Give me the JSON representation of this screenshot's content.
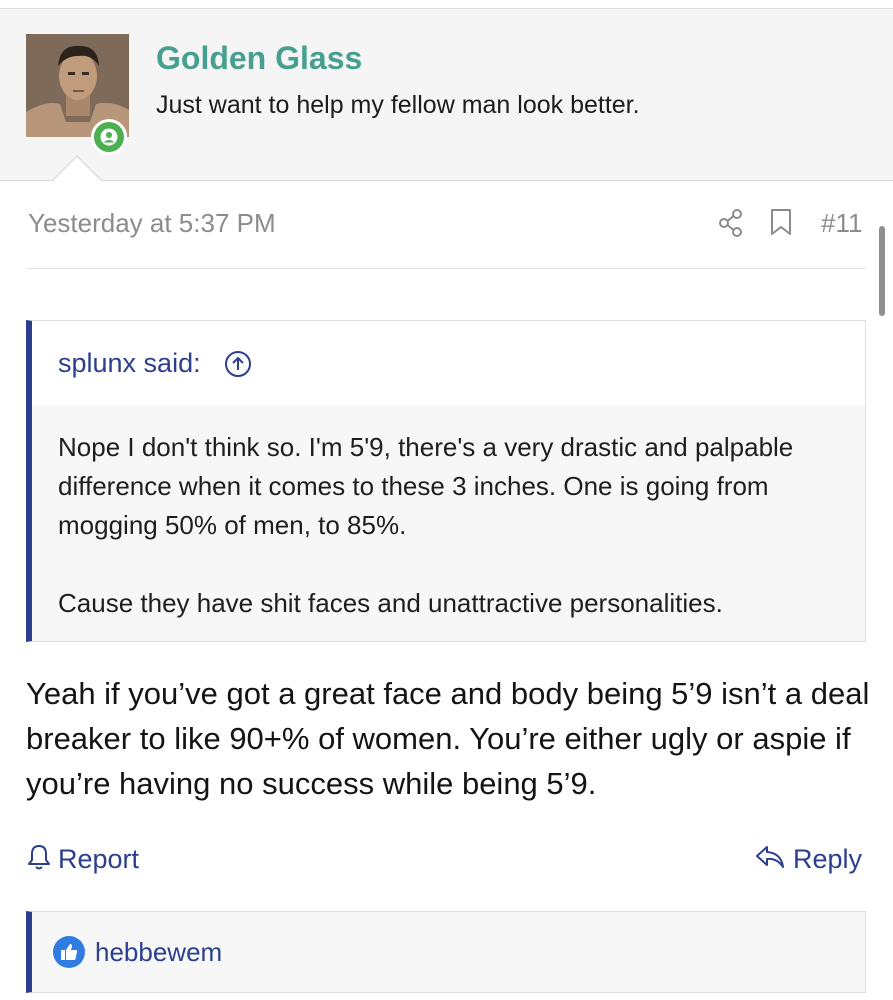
{
  "user": {
    "name": "Golden Glass",
    "title": "Just want to help my fellow man look better."
  },
  "post": {
    "time": "Yesterday at 5:37 PM",
    "number": "#11",
    "message": "Yeah if you’ve got a great face and body being 5’9 isn’t a deal breaker to like 90+% of women. You’re either ugly or aspie if you’re having no success while being 5’9."
  },
  "quote": {
    "author": "splunx said:",
    "paragraph1": "Nope I don't think so. I'm 5'9, there's a very drastic and palpable difference when it comes to these 3 inches. One is going from mogging 50% of men, to 85%.",
    "paragraph2": "Cause they have shit faces and unattractive personalities."
  },
  "actions": {
    "report": "Report",
    "reply": "Reply"
  },
  "reactions": {
    "user": "hebbewem"
  },
  "icons": {
    "online": "user-icon",
    "share": "share-icon",
    "bookmark": "bookmark-icon",
    "expand": "arrow-up-circle-icon",
    "report": "bell-icon",
    "reply": "reply-arrow-icon",
    "like": "thumbs-up-icon"
  },
  "colors": {
    "username": "#47a08f",
    "link": "#2c3e8e",
    "online": "#4caf50",
    "like": "#2f7de1"
  }
}
